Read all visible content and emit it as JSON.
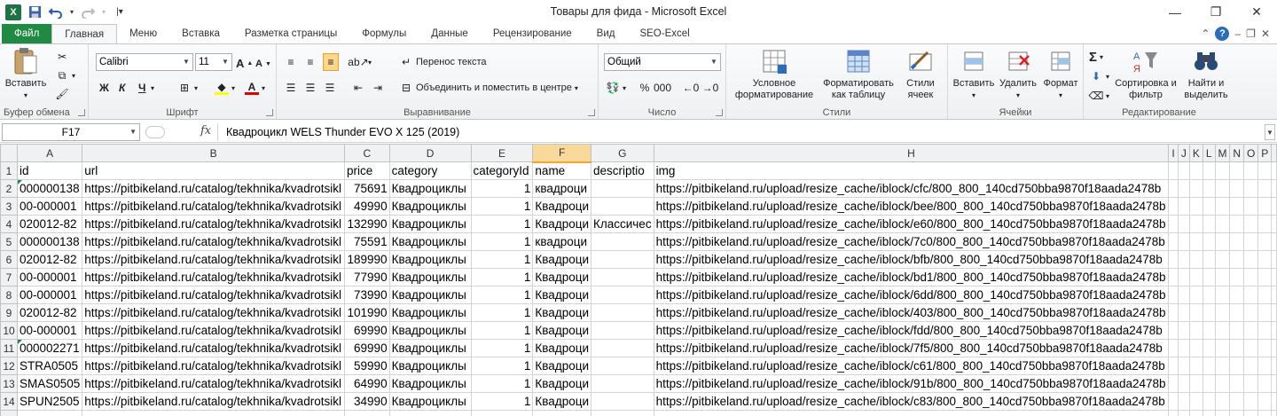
{
  "window": {
    "title": "Товары для фида  -  Microsoft Excel"
  },
  "tabs": [
    {
      "label": "Файл"
    },
    {
      "label": "Главная"
    },
    {
      "label": "Меню"
    },
    {
      "label": "Вставка"
    },
    {
      "label": "Разметка страницы"
    },
    {
      "label": "Формулы"
    },
    {
      "label": "Данные"
    },
    {
      "label": "Рецензирование"
    },
    {
      "label": "Вид"
    },
    {
      "label": "SEO-Excel"
    }
  ],
  "ribbon": {
    "clipboard": {
      "group": "Буфер обмена",
      "paste": "Вставить"
    },
    "font": {
      "group": "Шрифт",
      "name": "Calibri",
      "size": "11",
      "bold": "Ж",
      "italic": "К",
      "underline": "Ч"
    },
    "align": {
      "group": "Выравнивание",
      "wrap": "Перенос текста",
      "merge": "Объединить и поместить в центре"
    },
    "number": {
      "group": "Число",
      "format": "Общий"
    },
    "styles": {
      "group": "Стили",
      "conditional": "Условное форматирование",
      "astable": "Форматировать как таблицу",
      "cellstyles": "Стили ячеек"
    },
    "cells": {
      "group": "Ячейки",
      "insert": "Вставить",
      "delete": "Удалить",
      "format": "Формат"
    },
    "editing": {
      "group": "Редактирование",
      "sort": "Сортировка и фильтр",
      "find": "Найти и выделить"
    }
  },
  "formula_bar": {
    "cell": "F17",
    "fx": "fx",
    "value": "Квадроцикл WELS Thunder EVO X 125 (2019)"
  },
  "sheet": {
    "columns": [
      "A",
      "B",
      "C",
      "D",
      "E",
      "F",
      "G",
      "H",
      "I",
      "J",
      "K",
      "L",
      "M",
      "N",
      "O",
      "P",
      ""
    ],
    "selected_column": "F",
    "rows": [
      {
        "n": "1",
        "cells": [
          "id",
          "url",
          "price",
          "category",
          "categoryId",
          "name",
          "descriptio",
          "img",
          "",
          "",
          "",
          "",
          "",
          "",
          "",
          "",
          ""
        ]
      },
      {
        "n": "2",
        "cells": [
          "000000138",
          "https://pitbikeland.ru/catalog/tekhnika/kvadrotsikl",
          "75691",
          "Квадроциклы",
          "1",
          "квадроци",
          "",
          "https://pitbikeland.ru/upload/resize_cache/iblock/cfc/800_800_140cd750bba9870f18aada2478b",
          "",
          "",
          "",
          "",
          "",
          "",
          "",
          "",
          ""
        ]
      },
      {
        "n": "3",
        "cells": [
          "00-000001",
          "https://pitbikeland.ru/catalog/tekhnika/kvadrotsikl",
          "49990",
          "Квадроциклы",
          "1",
          "Квадроци",
          "",
          "https://pitbikeland.ru/upload/resize_cache/iblock/bee/800_800_140cd750bba9870f18aada2478b",
          "",
          "",
          "",
          "",
          "",
          "",
          "",
          "",
          ""
        ]
      },
      {
        "n": "4",
        "cells": [
          "020012-82",
          "https://pitbikeland.ru/catalog/tekhnika/kvadrotsikl",
          "132990",
          "Квадроциклы",
          "1",
          "Квадроци",
          "Классичес",
          "https://pitbikeland.ru/upload/resize_cache/iblock/e60/800_800_140cd750bba9870f18aada2478b",
          "",
          "",
          "",
          "",
          "",
          "",
          "",
          "",
          ""
        ]
      },
      {
        "n": "5",
        "cells": [
          "000000138",
          "https://pitbikeland.ru/catalog/tekhnika/kvadrotsikl",
          "75591",
          "Квадроциклы",
          "1",
          "квадроци",
          "",
          "https://pitbikeland.ru/upload/resize_cache/iblock/7c0/800_800_140cd750bba9870f18aada2478b",
          "",
          "",
          "",
          "",
          "",
          "",
          "",
          "",
          ""
        ]
      },
      {
        "n": "6",
        "cells": [
          "020012-82",
          "https://pitbikeland.ru/catalog/tekhnika/kvadrotsikl",
          "189990",
          "Квадроциклы",
          "1",
          "Квадроци",
          "",
          "https://pitbikeland.ru/upload/resize_cache/iblock/bfb/800_800_140cd750bba9870f18aada2478b",
          "",
          "",
          "",
          "",
          "",
          "",
          "",
          "",
          ""
        ]
      },
      {
        "n": "7",
        "cells": [
          "00-000001",
          "https://pitbikeland.ru/catalog/tekhnika/kvadrotsikl",
          "77990",
          "Квадроциклы",
          "1",
          "Квадроци",
          "",
          "https://pitbikeland.ru/upload/resize_cache/iblock/bd1/800_800_140cd750bba9870f18aada2478b",
          "",
          "",
          "",
          "",
          "",
          "",
          "",
          "",
          ""
        ]
      },
      {
        "n": "8",
        "cells": [
          "00-000001",
          "https://pitbikeland.ru/catalog/tekhnika/kvadrotsikl",
          "73990",
          "Квадроциклы",
          "1",
          "Квадроци",
          "",
          "https://pitbikeland.ru/upload/resize_cache/iblock/6dd/800_800_140cd750bba9870f18aada2478b",
          "",
          "",
          "",
          "",
          "",
          "",
          "",
          "",
          ""
        ]
      },
      {
        "n": "9",
        "cells": [
          "020012-82",
          "https://pitbikeland.ru/catalog/tekhnika/kvadrotsikl",
          "101990",
          "Квадроциклы",
          "1",
          "Квадроци",
          "",
          "https://pitbikeland.ru/upload/resize_cache/iblock/403/800_800_140cd750bba9870f18aada2478b",
          "",
          "",
          "",
          "",
          "",
          "",
          "",
          "",
          ""
        ]
      },
      {
        "n": "10",
        "cells": [
          "00-000001",
          "https://pitbikeland.ru/catalog/tekhnika/kvadrotsikl",
          "69990",
          "Квадроциклы",
          "1",
          "Квадроци",
          "",
          "https://pitbikeland.ru/upload/resize_cache/iblock/fdd/800_800_140cd750bba9870f18aada2478b",
          "",
          "",
          "",
          "",
          "",
          "",
          "",
          "",
          ""
        ]
      },
      {
        "n": "11",
        "cells": [
          "000002271",
          "https://pitbikeland.ru/catalog/tekhnika/kvadrotsikl",
          "69990",
          "Квадроциклы",
          "1",
          "Квадроци",
          "",
          "https://pitbikeland.ru/upload/resize_cache/iblock/7f5/800_800_140cd750bba9870f18aada2478b",
          "",
          "",
          "",
          "",
          "",
          "",
          "",
          "",
          ""
        ]
      },
      {
        "n": "12",
        "cells": [
          "STRA0505",
          "https://pitbikeland.ru/catalog/tekhnika/kvadrotsikl",
          "59990",
          "Квадроциклы",
          "1",
          "Квадроци",
          "",
          "https://pitbikeland.ru/upload/resize_cache/iblock/c61/800_800_140cd750bba9870f18aada2478b",
          "",
          "",
          "",
          "",
          "",
          "",
          "",
          "",
          ""
        ]
      },
      {
        "n": "13",
        "cells": [
          "SMAS0505",
          "https://pitbikeland.ru/catalog/tekhnika/kvadrotsikl",
          "64990",
          "Квадроциклы",
          "1",
          "Квадроци",
          "",
          "https://pitbikeland.ru/upload/resize_cache/iblock/91b/800_800_140cd750bba9870f18aada2478b",
          "",
          "",
          "",
          "",
          "",
          "",
          "",
          "",
          ""
        ]
      },
      {
        "n": "14",
        "cells": [
          "SPUN2505",
          "https://pitbikeland.ru/catalog/tekhnika/kvadrotsikl",
          "34990",
          "Квадроциклы",
          "1",
          "Квадроци",
          "",
          "https://pitbikeland.ru/upload/resize_cache/iblock/c83/800_800_140cd750bba9870f18aada2478b",
          "",
          "",
          "",
          "",
          "",
          "",
          "",
          "",
          ""
        ]
      },
      {
        "n": "",
        "cells": [
          "",
          "",
          "",
          "",
          "",
          "",
          "",
          "",
          "",
          "",
          "",
          "",
          "",
          "",
          "",
          "",
          ""
        ]
      }
    ]
  }
}
